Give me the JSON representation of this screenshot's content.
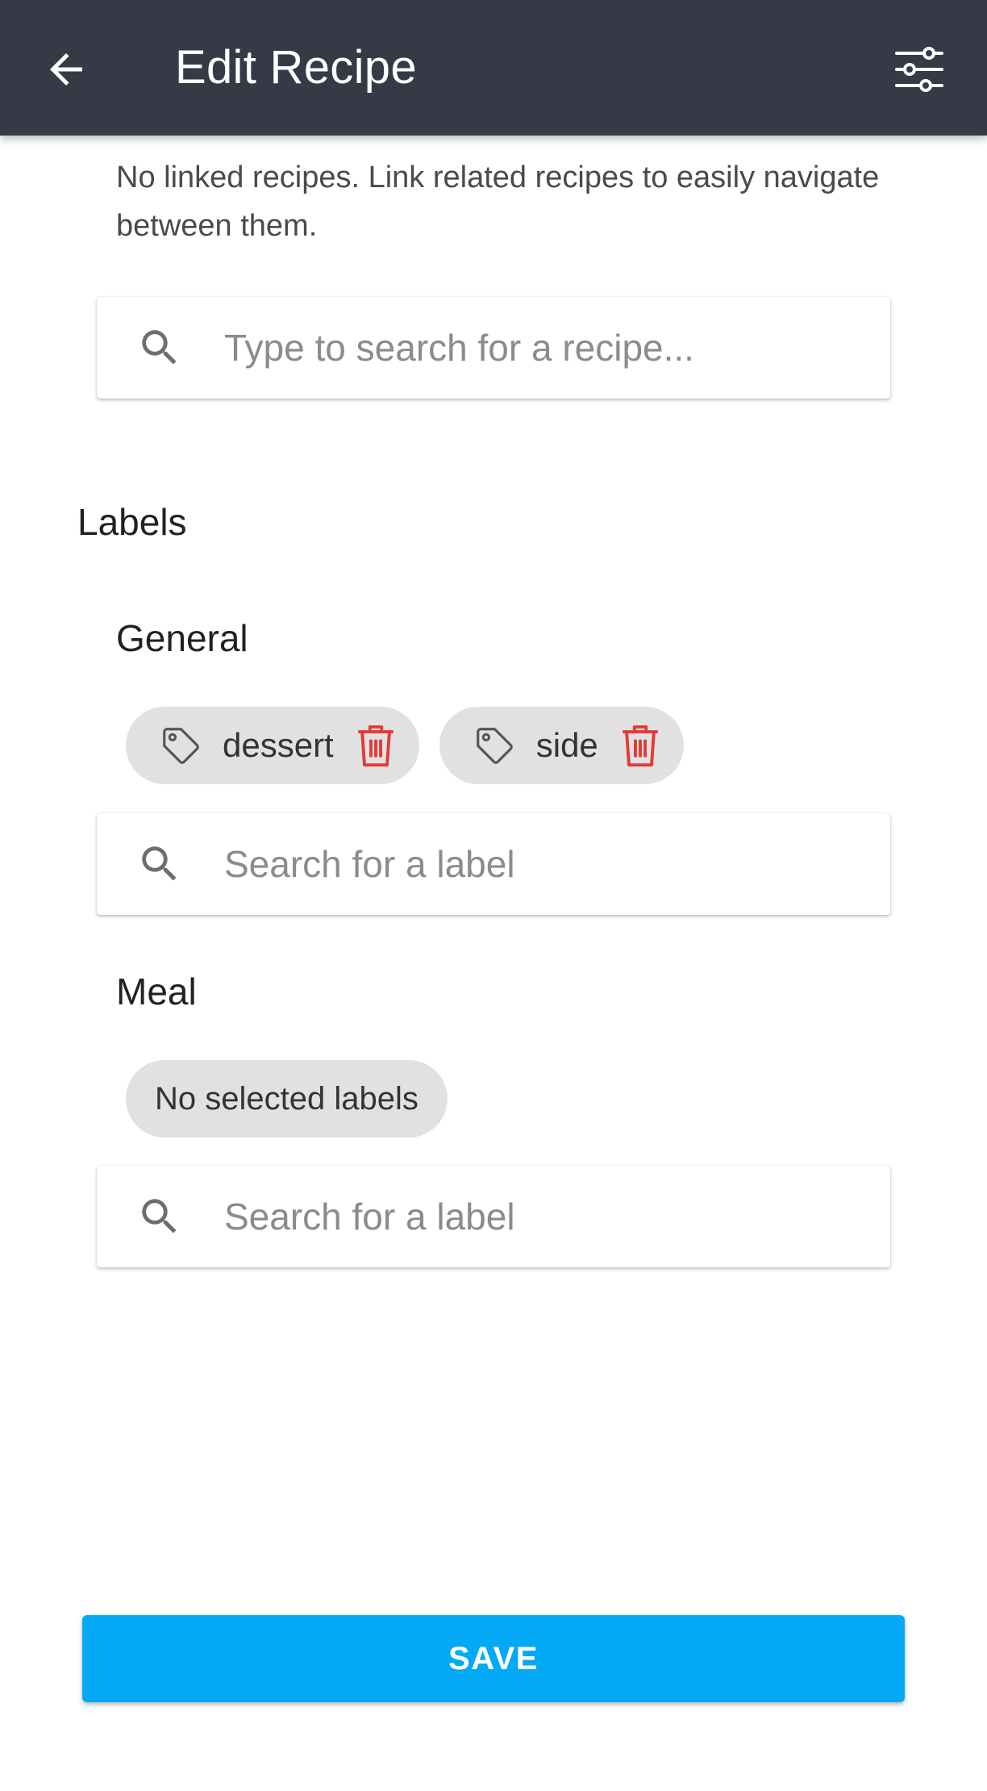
{
  "header": {
    "title": "Edit Recipe",
    "back_icon": "arrow-left-icon",
    "filter_icon": "sliders-icon",
    "background": "#363a47"
  },
  "linked_recipes": {
    "empty_text": "No linked recipes. Link related recipes to easily navigate between them.",
    "search_placeholder": "Type to search for a recipe..."
  },
  "labels": {
    "section_title": "Labels",
    "groups": [
      {
        "title": "General",
        "chips": [
          {
            "label": "dessert",
            "icon": "tag-icon",
            "remove_icon": "trash-icon"
          },
          {
            "label": "side",
            "icon": "tag-icon",
            "remove_icon": "trash-icon"
          }
        ],
        "search_placeholder": "Search for a label"
      },
      {
        "title": "Meal",
        "empty_label": "No selected labels",
        "search_placeholder": "Search for a label"
      }
    ]
  },
  "footer": {
    "save_label": "SAVE",
    "save_color": "#03a9f4"
  },
  "colors": {
    "chip_bg": "#e1e1e1",
    "trash": "#e53935"
  }
}
